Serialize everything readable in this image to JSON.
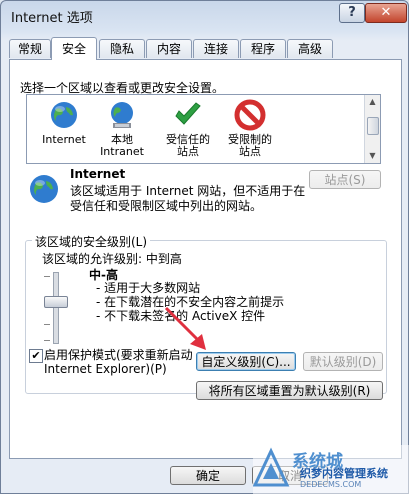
{
  "window": {
    "title": "Internet 选项",
    "help_label": "?",
    "close_label": "✕"
  },
  "tabs": [
    "常规",
    "安全",
    "隐私",
    "内容",
    "连接",
    "程序",
    "高级"
  ],
  "active_tab": "安全",
  "zones": {
    "intro": "选择一个区域以查看或更改安全设置。",
    "items": [
      {
        "label": "Internet",
        "icon": "globe-icon"
      },
      {
        "label": "本地\nIntranet",
        "icon": "intranet-globe-icon"
      },
      {
        "label": "受信任的\n站点",
        "icon": "checkmark-icon"
      },
      {
        "label": "受限制的\n站点",
        "icon": "restricted-icon"
      }
    ]
  },
  "selected_zone": {
    "name": "Internet",
    "description": "该区域适用于 Internet 网站，但不适用于在受信任和受限制区域中列出的网站。",
    "sites_button": "站点(S)"
  },
  "security_level": {
    "legend": "该区域的安全级别(L)",
    "allowed": "该区域的允许级别: 中到高",
    "level": "中-高",
    "bullets": [
      "- 适用于大多数网站",
      "- 在下载潜在的不安全内容之前提示",
      "- 不下载未签名的 ActiveX 控件"
    ],
    "protected_mode_label": "启用保护模式(要求重新启动\nInternet Explorer)(P)",
    "protected_mode_checked": true,
    "custom_level_button": "自定义级别(C)...",
    "default_level_button": "默认级别(D)",
    "reset_all_button": "将所有区域重置为默认级别(R)"
  },
  "footer": {
    "ok_button": "确定",
    "cancel_button": "取消"
  },
  "watermark": {
    "line1": "系统城",
    "line2": "织梦内容管理系统",
    "line3": "DEDECMS.COM"
  },
  "colors": {
    "accent": "#1e5aa8",
    "annotation_arrow": "#e0303f",
    "window_frame": "#6f7f99"
  }
}
